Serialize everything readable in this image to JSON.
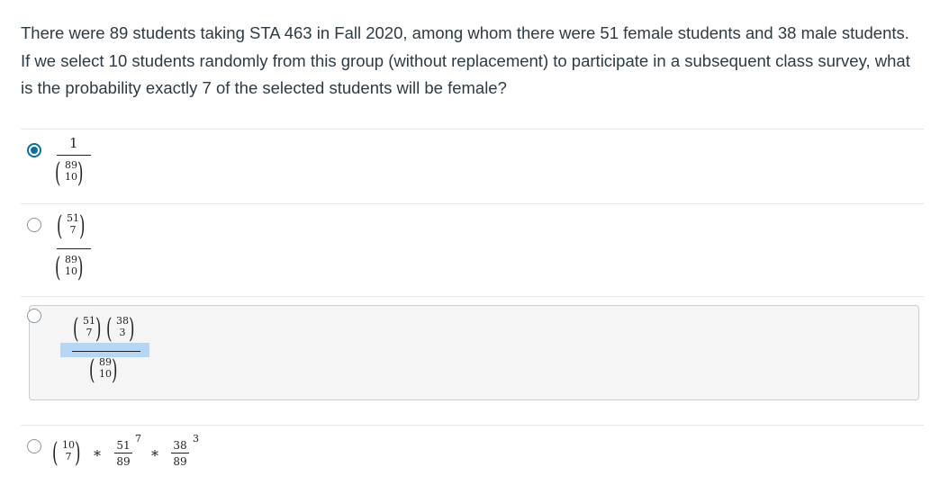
{
  "question": {
    "text": "There were 89 students taking STA 463 in Fall 2020, among whom there were 51 female students and 38 male students.  If we select 10 students randomly from this group (without replacement) to participate in a subsequent class survey,  what is the probability exactly 7 of the selected students will be female?"
  },
  "answers": [
    {
      "selected": true,
      "numerator": "1",
      "denominator": {
        "n": "89",
        "k": "10"
      }
    },
    {
      "selected": false,
      "numerator": {
        "n": "51",
        "k": "7"
      },
      "denominator": {
        "n": "89",
        "k": "10"
      }
    },
    {
      "selected": false,
      "numerator_a": {
        "n": "51",
        "k": "7"
      },
      "numerator_b": {
        "n": "38",
        "k": "3"
      },
      "denominator": {
        "n": "89",
        "k": "10"
      }
    },
    {
      "selected": false,
      "binom": {
        "n": "10",
        "k": "7"
      },
      "times": "*",
      "frac1": {
        "num": "51",
        "den": "89",
        "exp": "7"
      },
      "frac2": {
        "num": "38",
        "den": "89",
        "exp": "3"
      }
    }
  ],
  "colors": {
    "accent": "#0770a3",
    "highlight": "#b4d7f8",
    "hover_bg": "#f5f5f5"
  }
}
